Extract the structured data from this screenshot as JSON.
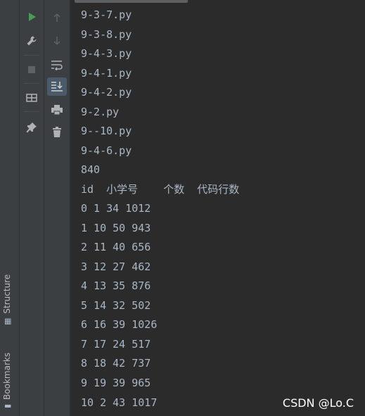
{
  "side_tabs": {
    "structure": "Structure",
    "bookmarks": "Bookmarks"
  },
  "toolbar": {
    "run_icon": "run-icon",
    "settings_icon": "wrench-icon",
    "stop_icon": "stop-icon",
    "layout_icon": "layout-icon",
    "pin_icon": "pin-icon",
    "up_icon": "arrow-up-icon",
    "down_icon": "arrow-down-icon",
    "wrap_icon": "soft-wrap-icon",
    "scroll_end_icon": "scroll-to-end-icon",
    "print_icon": "print-icon",
    "trash_icon": "trash-icon"
  },
  "colors": {
    "run": "#499c54",
    "output_text": "#a9b7c6",
    "background": "#2b2b2b",
    "panel": "#3c3f41"
  },
  "console": {
    "lines": [
      "9-3-7.py",
      "9-3-8.py",
      "9-4-3.py",
      "9-4-1.py",
      "9-4-2.py",
      "9-2.py",
      "9--10.py",
      "9-4-6.py",
      "840",
      "id  小学号    个数  代码行数",
      "0 1 34 1012",
      "1 10 50 943",
      "2 11 40 656",
      "3 12 27 462",
      "4 13 35 876",
      "5 14 32 502",
      "6 16 39 1026",
      "7 17 24 517",
      "8 18 42 737",
      "9 19 39 965",
      "10 2 43 1017"
    ]
  },
  "watermark": "CSDN @Lo.C"
}
